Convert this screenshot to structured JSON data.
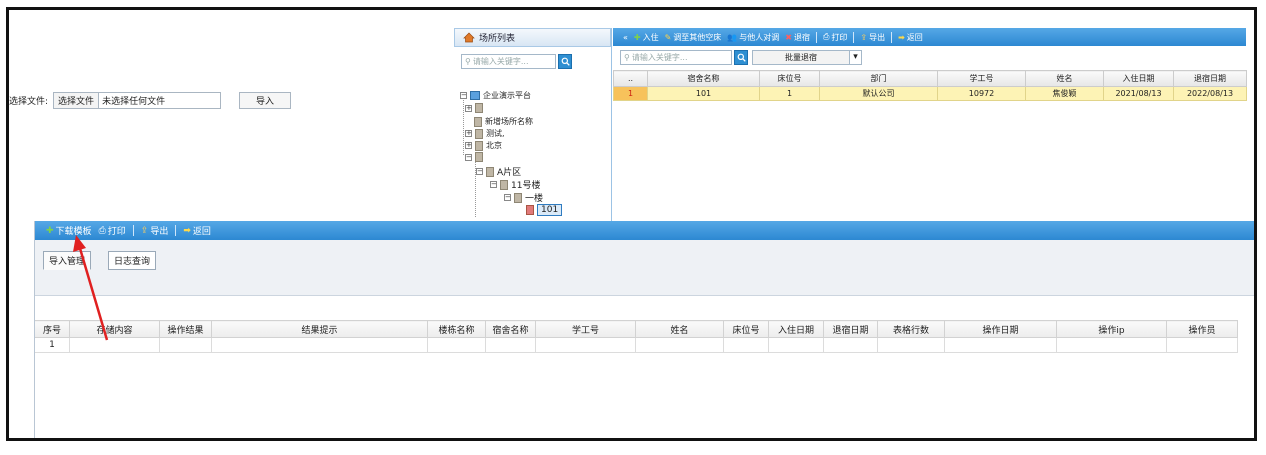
{
  "tree_panel": {
    "title": "场所列表",
    "search_placeholder": "请输入关键字...",
    "nodes": {
      "root": "企业演示平台",
      "n1": "",
      "n2": "新增场所名称",
      "n3": "测试,",
      "n4": "北京",
      "n5": "",
      "area": "A片区",
      "building": "11号楼",
      "floor": "一楼",
      "room": "101"
    }
  },
  "grid_panel": {
    "toolbar": {
      "collapse": "«",
      "checkin": "入住",
      "move_empty": "调至其他空床",
      "swap": "与他人对调",
      "checkout": "退宿",
      "print": "打印",
      "export": "导出",
      "back": "返回"
    },
    "search_placeholder": "请输入关键字...",
    "batch_select": "批量退宿",
    "columns": [
      "..",
      "宿舍名称",
      "床位号",
      "部门",
      "学工号",
      "姓名",
      "入住日期",
      "退宿日期"
    ],
    "rows": [
      [
        "1",
        "101",
        "1",
        "默认公司",
        "10972",
        "焦俊颖",
        "2021/08/13",
        "2022/08/13"
      ]
    ]
  },
  "import_panel": {
    "toolbar": {
      "download_template": "下载模板",
      "print": "打印",
      "export": "导出",
      "back": "返回"
    },
    "tabs": [
      "导入管理",
      "日志查询"
    ],
    "file_label": "选择文件:",
    "choose_button": "选择文件",
    "no_file": "未选择任何文件",
    "import_button": "导入",
    "columns": [
      "序号",
      "存储内容",
      "操作结果",
      "结果提示",
      "楼栋名称",
      "宿舍名称",
      "学工号",
      "姓名",
      "床位号",
      "入住日期",
      "退宿日期",
      "表格行数",
      "操作日期",
      "操作ip",
      "操作员"
    ],
    "rows": [
      [
        "1",
        "",
        "",
        "",
        "",
        "",
        "",
        "",
        "",
        "",
        "",
        "",
        "",
        "",
        ""
      ]
    ]
  },
  "colors": {
    "toolbar_blue": "#2c88d2",
    "selected_row": "#fdf3b5",
    "annotation_arrow": "#e02020"
  }
}
